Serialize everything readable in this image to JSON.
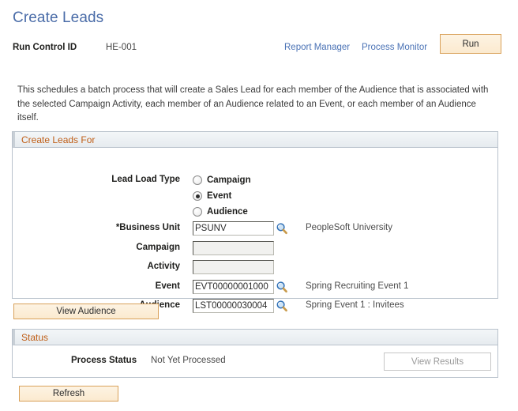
{
  "header": {
    "title": "Create Leads",
    "run_control_label": "Run Control ID",
    "run_control_value": "HE-001",
    "report_manager_link": "Report Manager",
    "process_monitor_link": "Process Monitor",
    "run_button": "Run"
  },
  "intro": "This schedules a batch process that will create a Sales Lead for each member of the Audience that is associated with the selected Campaign Activity, each member of an Audience related to an Event, or each member of an Audience itself.",
  "create_leads_for": {
    "header": "Create Leads For",
    "lead_load_type_label": "Lead Load Type",
    "radio_options": [
      {
        "label": "Campaign",
        "selected": false
      },
      {
        "label": "Event",
        "selected": true
      },
      {
        "label": "Audience",
        "selected": false
      }
    ],
    "fields": [
      {
        "label": "*Business Unit",
        "value": "PSUNV",
        "description": "PeopleSoft University",
        "readonly": false,
        "has_lookup": true
      },
      {
        "label": "Campaign",
        "value": "",
        "description": "",
        "readonly": true,
        "has_lookup": false
      },
      {
        "label": "Activity",
        "value": "",
        "description": "",
        "readonly": true,
        "has_lookup": false
      },
      {
        "label": "Event",
        "value": "EVT00000001000",
        "description": "Spring Recruiting Event 1",
        "readonly": false,
        "has_lookup": true
      },
      {
        "label": "Audience",
        "value": "LST00000030004",
        "description": "Spring Event 1 : Invitees",
        "readonly": false,
        "has_lookup": true
      }
    ],
    "view_audience_button": "View Audience"
  },
  "status": {
    "header": "Status",
    "process_status_label": "Process Status",
    "process_status_value": "Not Yet Processed",
    "view_results_button": "View Results"
  },
  "refresh_button": "Refresh",
  "colors": {
    "title_blue": "#4a6ca8",
    "link_blue": "#4a72b5",
    "group_header_orange": "#c05f18",
    "button_border": "#d9a15a",
    "button_fill": "#fbeacf"
  }
}
